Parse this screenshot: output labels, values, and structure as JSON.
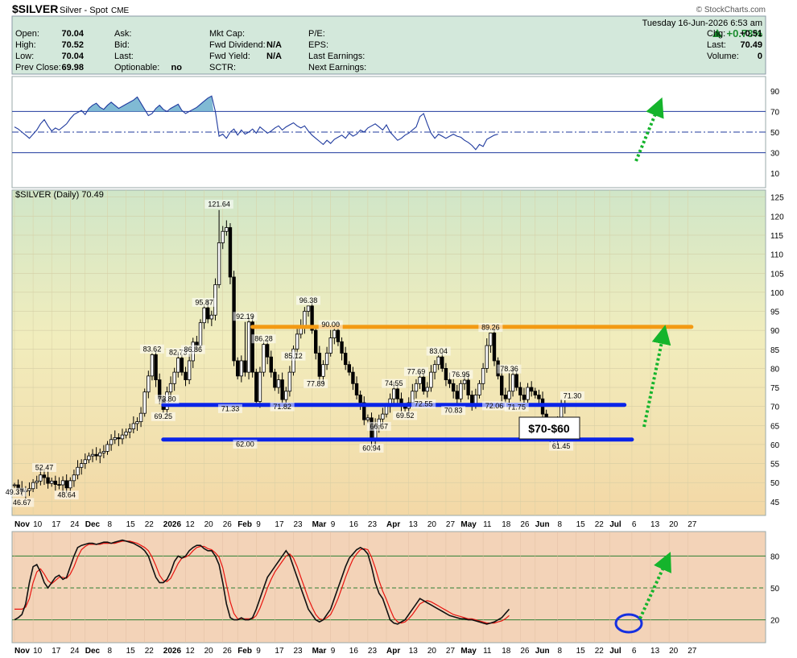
{
  "header": {
    "symbol": "$SILVER",
    "name": "Silver - Spot",
    "exchange": "CME",
    "brand": "© StockCharts.com",
    "datetime": "Tuesday  16-Jun-2026  6:53 am",
    "pct_change": "+0.73%",
    "info_rows": [
      [
        {
          "label": "Open:",
          "value": "70.04"
        },
        {
          "label": "Ask:",
          "value": ""
        },
        {
          "label": "Mkt Cap:",
          "value": ""
        },
        {
          "label": "P/E:",
          "value": ""
        },
        {
          "label": "Chg:",
          "value": "+0.51"
        }
      ],
      [
        {
          "label": "High:",
          "value": "70.52"
        },
        {
          "label": "Bid:",
          "value": ""
        },
        {
          "label": "Fwd Dividend:",
          "value": "N/A"
        },
        {
          "label": "EPS:",
          "value": ""
        },
        {
          "label": "Last:",
          "value": "70.49"
        }
      ],
      [
        {
          "label": "Low:",
          "value": "70.04"
        },
        {
          "label": "Last:",
          "value": ""
        },
        {
          "label": "Fwd Yield:",
          "value": "N/A"
        },
        {
          "label": "Last Earnings:",
          "value": ""
        },
        {
          "label": "Volume:",
          "value": "0"
        }
      ],
      [
        {
          "label": "Prev Close:",
          "value": "69.98"
        },
        {
          "label": "Optionable:",
          "value": "no"
        },
        {
          "label": "SCTR:",
          "value": ""
        },
        {
          "label": "Next Earnings:",
          "value": ""
        }
      ]
    ]
  },
  "chart_data": [
    {
      "type": "line",
      "panel": "rsi",
      "ylim": [
        0,
        100
      ],
      "ticks": [
        10,
        30,
        50,
        70,
        90
      ],
      "overbought": 70,
      "oversold": 30,
      "midline": 50,
      "overbought_fill_color": "#6aaecd",
      "values": [
        55,
        53,
        50,
        47,
        44,
        48,
        52,
        58,
        62,
        56,
        51,
        54,
        52,
        55,
        58,
        63,
        67,
        69,
        71,
        67,
        73,
        76,
        78,
        74,
        72,
        76,
        79,
        76,
        73,
        75,
        77,
        79,
        81,
        84,
        78,
        72,
        66,
        68,
        73,
        76,
        72,
        70,
        73,
        75,
        77,
        71,
        68,
        70,
        72,
        74,
        77,
        80,
        83,
        85,
        70,
        46,
        48,
        44,
        50,
        53,
        47,
        52,
        48,
        50,
        53,
        49,
        55,
        52,
        49,
        51,
        54,
        56,
        52,
        55,
        57,
        59,
        56,
        54,
        56,
        51,
        47,
        44,
        41,
        38,
        42,
        39,
        43,
        45,
        47,
        44,
        49,
        46,
        48,
        52,
        50,
        54,
        56,
        58,
        55,
        52,
        57,
        50,
        46,
        42,
        44,
        47,
        49,
        52,
        55,
        65,
        68,
        58,
        49,
        44,
        48,
        46,
        44,
        46,
        48,
        46,
        45,
        42,
        40,
        37,
        33,
        38,
        36,
        43,
        45,
        47,
        48
      ],
      "current_dot": 48
    },
    {
      "type": "candlestick",
      "panel": "price",
      "title": "$SILVER (Daily) 70.49",
      "ylim": [
        42,
        126
      ],
      "yticks": [
        45,
        50,
        55,
        60,
        65,
        70,
        75,
        80,
        85,
        90,
        95,
        100,
        105,
        110,
        115,
        120,
        125
      ],
      "xlabels": [
        {
          "i": 0,
          "t": "Nov",
          "bold": true
        },
        {
          "i": 5,
          "t": "10"
        },
        {
          "i": 10,
          "t": "17"
        },
        {
          "i": 15,
          "t": "24"
        },
        {
          "i": 19,
          "t": "Dec",
          "bold": true
        },
        {
          "i": 25,
          "t": "8"
        },
        {
          "i": 30,
          "t": "15"
        },
        {
          "i": 35,
          "t": "22"
        },
        {
          "i": 40,
          "t": "2026",
          "bold": true
        },
        {
          "i": 46,
          "t": "12"
        },
        {
          "i": 51,
          "t": "20"
        },
        {
          "i": 56,
          "t": "26"
        },
        {
          "i": 60,
          "t": "Feb",
          "bold": true
        },
        {
          "i": 65,
          "t": "9"
        },
        {
          "i": 70,
          "t": "17"
        },
        {
          "i": 75,
          "t": "23"
        },
        {
          "i": 80,
          "t": "Mar",
          "bold": true
        },
        {
          "i": 85,
          "t": "9"
        },
        {
          "i": 90,
          "t": "16"
        },
        {
          "i": 95,
          "t": "23"
        },
        {
          "i": 100,
          "t": "Apr",
          "bold": true
        },
        {
          "i": 106,
          "t": "13"
        },
        {
          "i": 111,
          "t": "20"
        },
        {
          "i": 116,
          "t": "27"
        },
        {
          "i": 120,
          "t": "May",
          "bold": true
        },
        {
          "i": 126,
          "t": "11"
        },
        {
          "i": 131,
          "t": "18"
        },
        {
          "i": 136,
          "t": "26"
        },
        {
          "i": 140,
          "t": "Jun",
          "bold": true
        },
        {
          "i": 146,
          "t": "8"
        },
        {
          "i": 151,
          "t": "15"
        },
        {
          "i": 156,
          "t": "22"
        },
        {
          "i": 160,
          "t": "Jul",
          "bold": true
        },
        {
          "i": 166,
          "t": "6"
        },
        {
          "i": 171,
          "t": "13"
        },
        {
          "i": 176,
          "t": "20"
        },
        {
          "i": 181,
          "t": "27"
        }
      ],
      "closes": [
        49.4,
        48.5,
        47.6,
        47.9,
        48.4,
        50.0,
        50.4,
        52.0,
        51.3,
        49.8,
        50.4,
        49.5,
        49.4,
        50.5,
        48.6,
        50.5,
        52.0,
        54.0,
        55.0,
        56.0,
        57.0,
        57.4,
        57.0,
        57.8,
        58.2,
        60.0,
        61.3,
        61.8,
        61.5,
        62.5,
        63.3,
        64.1,
        65.5,
        66.0,
        68.2,
        73.8,
        78.0,
        83.6,
        77.0,
        72.0,
        69.2,
        73.8,
        76.0,
        79.0,
        82.7,
        79.0,
        77.0,
        82.0,
        86.9,
        86.0,
        92.0,
        95.9,
        93.0,
        94.0,
        102.0,
        113.0,
        116.0,
        117.0,
        104.0,
        82.0,
        78.0,
        82.0,
        79.0,
        92.2,
        79.0,
        71.3,
        79.0,
        86.3,
        83.0,
        79.0,
        75.0,
        77.0,
        71.8,
        74.0,
        79.0,
        85.1,
        89.0,
        91.0,
        95.0,
        96.4,
        90.0,
        84.0,
        77.9,
        81.0,
        84.0,
        88.0,
        90.0,
        87.0,
        84.0,
        81.0,
        79.0,
        76.0,
        73.0,
        71.0,
        66.5,
        67.0,
        60.9,
        65.0,
        66.7,
        68.0,
        70.0,
        72.0,
        74.6,
        72.0,
        70.0,
        69.5,
        71.0,
        74.0,
        76.0,
        77.7,
        74.0,
        75.0,
        79.0,
        81.0,
        83.0,
        80.0,
        77.0,
        76.0,
        74.0,
        72.0,
        76.0,
        76.9,
        73.0,
        70.8,
        73.0,
        76.0,
        80.0,
        86.0,
        89.3,
        82.0,
        78.0,
        73.0,
        72.0,
        74.0,
        78.4,
        75.0,
        73.0,
        71.8,
        75.0,
        74.0,
        73.0,
        72.0,
        68.0,
        65.0,
        62.0,
        61.5,
        66.0,
        70.0,
        70.49
      ],
      "highs_override": {
        "0": 49.9,
        "37": 84.0,
        "51": 96.5,
        "55": 121.6,
        "62": 92.2,
        "67": 87.0,
        "79": 96.4,
        "85": 90.1,
        "114": 83.5,
        "128": 89.3,
        "133": 78.8,
        "150": 71.3
      },
      "labels": [
        {
          "i": 0,
          "v": 49.37,
          "text": "49.37",
          "pos": "below"
        },
        {
          "i": 2,
          "v": 46.67,
          "text": "46.67",
          "pos": "below"
        },
        {
          "i": 8,
          "v": 52.47,
          "text": "52.47",
          "pos": "above"
        },
        {
          "i": 14,
          "v": 48.64,
          "text": "48.64",
          "pos": "below"
        },
        {
          "i": 37,
          "v": 83.62,
          "text": "83.62",
          "pos": "above"
        },
        {
          "i": 40,
          "v": 69.25,
          "text": "69.25",
          "pos": "below"
        },
        {
          "i": 41,
          "v": 73.8,
          "text": "73.80",
          "pos": "below"
        },
        {
          "i": 44,
          "v": 82.73,
          "text": "82.73",
          "pos": "above"
        },
        {
          "i": 48,
          "v": 86.86,
          "text": "86.86",
          "pos": "below"
        },
        {
          "i": 51,
          "v": 95.87,
          "text": "95.87",
          "pos": "above"
        },
        {
          "i": 55,
          "v": 121.64,
          "text": "121.64",
          "pos": "above"
        },
        {
          "i": 62,
          "v": 92.19,
          "text": "92.19",
          "pos": "above"
        },
        {
          "i": 58,
          "v": 71.33,
          "text": "71.33",
          "pos": "below"
        },
        {
          "i": 62,
          "v": 62.0,
          "text": "62.00",
          "pos": "below"
        },
        {
          "i": 67,
          "v": 86.28,
          "text": "86.28",
          "pos": "above"
        },
        {
          "i": 72,
          "v": 71.82,
          "text": "71.82",
          "pos": "below"
        },
        {
          "i": 75,
          "v": 85.12,
          "text": "85.12",
          "pos": "below"
        },
        {
          "i": 79,
          "v": 96.38,
          "text": "96.38",
          "pos": "above"
        },
        {
          "i": 81,
          "v": 77.89,
          "text": "77.89",
          "pos": "below"
        },
        {
          "i": 85,
          "v": 90.0,
          "text": "90.00",
          "pos": "above"
        },
        {
          "i": 96,
          "v": 60.94,
          "text": "60.94",
          "pos": "below"
        },
        {
          "i": 98,
          "v": 66.67,
          "text": "66.67",
          "pos": "below"
        },
        {
          "i": 102,
          "v": 74.55,
          "text": "74.55",
          "pos": "above"
        },
        {
          "i": 105,
          "v": 69.52,
          "text": "69.52",
          "pos": "below"
        },
        {
          "i": 108,
          "v": 77.69,
          "text": "77.69",
          "pos": "above"
        },
        {
          "i": 110,
          "v": 72.55,
          "text": "72.55",
          "pos": "below"
        },
        {
          "i": 114,
          "v": 83.04,
          "text": "83.04",
          "pos": "above"
        },
        {
          "i": 120,
          "v": 76.95,
          "text": "76.95",
          "pos": "above"
        },
        {
          "i": 118,
          "v": 70.83,
          "text": "70.83",
          "pos": "below"
        },
        {
          "i": 128,
          "v": 89.26,
          "text": "89.26",
          "pos": "above"
        },
        {
          "i": 129,
          "v": 72.06,
          "text": "72.06",
          "pos": "below"
        },
        {
          "i": 133,
          "v": 78.36,
          "text": "78.36",
          "pos": "above"
        },
        {
          "i": 135,
          "v": 71.75,
          "text": "71.75",
          "pos": "below"
        },
        {
          "i": 150,
          "v": 71.3,
          "text": "71.30",
          "pos": "above"
        },
        {
          "i": 147,
          "v": 61.45,
          "text": "61.45",
          "pos": "below"
        }
      ],
      "annotation_box": "$70-$60",
      "resistance": {
        "value": 90.9,
        "i0": 64,
        "i1": 182,
        "color": "#f39a13"
      },
      "support_upper": {
        "value": 70.4,
        "i0": 40,
        "i1": 164,
        "color": "#0a24e8"
      },
      "support_lower": {
        "value": 61.3,
        "i0": 40,
        "i1": 166,
        "color": "#0a24e8"
      }
    },
    {
      "type": "line",
      "panel": "stochastic",
      "ylim": [
        0,
        100
      ],
      "ticks": [
        20,
        50,
        80
      ],
      "k_color": "#111111",
      "d_color": "#e8140f",
      "k": [
        20,
        22,
        25,
        35,
        55,
        70,
        72,
        65,
        55,
        50,
        55,
        60,
        62,
        58,
        60,
        70,
        80,
        88,
        90,
        91,
        92,
        92,
        91,
        92,
        93,
        93,
        92,
        93,
        94,
        95,
        94,
        93,
        92,
        90,
        88,
        85,
        80,
        70,
        60,
        55,
        55,
        58,
        65,
        75,
        80,
        78,
        80,
        85,
        88,
        90,
        90,
        87,
        85,
        85,
        80,
        72,
        55,
        35,
        22,
        20,
        20,
        22,
        20,
        20,
        22,
        30,
        40,
        50,
        60,
        65,
        70,
        75,
        80,
        85,
        80,
        70,
        60,
        50,
        40,
        30,
        25,
        20,
        18,
        20,
        25,
        30,
        40,
        50,
        60,
        70,
        78,
        82,
        86,
        88,
        86,
        82,
        70,
        55,
        45,
        40,
        30,
        20,
        17,
        16,
        18,
        20,
        25,
        30,
        35,
        40,
        38,
        36,
        34,
        32,
        30,
        28,
        26,
        24,
        23,
        22,
        21,
        21,
        20,
        20,
        19,
        18,
        17,
        16,
        17,
        18,
        20,
        22,
        26,
        30
      ],
      "d": [
        30,
        30,
        30,
        32,
        40,
        55,
        65,
        68,
        63,
        57,
        54,
        57,
        60,
        60,
        59,
        63,
        70,
        79,
        86,
        89,
        91,
        91,
        91,
        91,
        92,
        92,
        92,
        92,
        93,
        94,
        94,
        94,
        93,
        92,
        90,
        88,
        85,
        79,
        71,
        62,
        57,
        56,
        59,
        66,
        73,
        78,
        79,
        81,
        85,
        88,
        89,
        89,
        87,
        86,
        83,
        79,
        69,
        53,
        37,
        26,
        21,
        21,
        21,
        21,
        21,
        24,
        31,
        40,
        50,
        58,
        65,
        70,
        75,
        80,
        82,
        78,
        70,
        60,
        50,
        40,
        32,
        25,
        21,
        20,
        22,
        25,
        32,
        40,
        50,
        60,
        69,
        77,
        82,
        86,
        87,
        86,
        79,
        69,
        57,
        47,
        39,
        30,
        22,
        18,
        17,
        18,
        21,
        25,
        30,
        35,
        37,
        38,
        37,
        35,
        33,
        31,
        29,
        27,
        25,
        24,
        23,
        22,
        21,
        21,
        20,
        19,
        18,
        17,
        17,
        17,
        18,
        19,
        21,
        24
      ]
    }
  ]
}
